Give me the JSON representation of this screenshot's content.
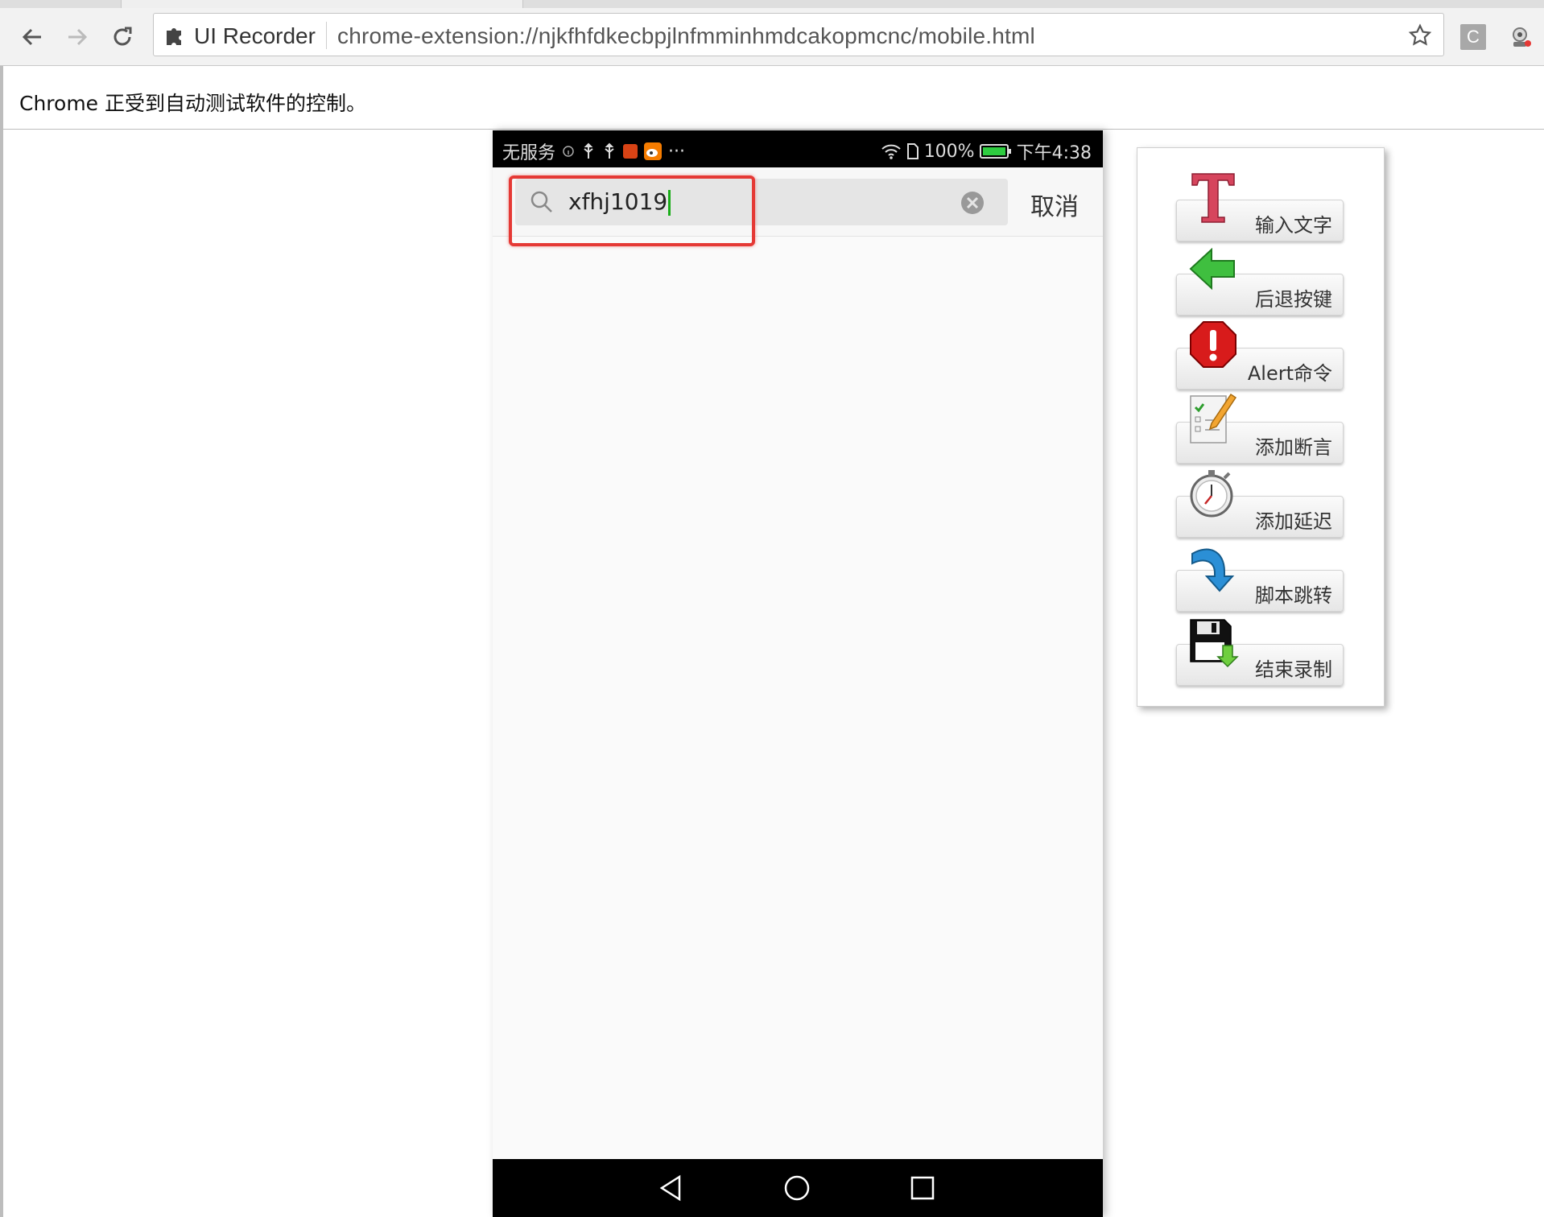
{
  "browser": {
    "site_name": "UI Recorder",
    "url": "chrome-extension://njkfhfdkecbpjlnfmminhmdcakopmcnc/mobile.html",
    "ext_c_label": "C",
    "infobar_text": "Chrome 正受到自动测试软件的控制。"
  },
  "phone": {
    "status": {
      "carrier": "无服务",
      "more": "···",
      "battery": "100%",
      "time": "下午4:38"
    },
    "search": {
      "query": "xfhj1019",
      "cancel_label": "取消"
    }
  },
  "panel": {
    "tools": [
      {
        "label": "输入文字",
        "icon": "text-t-icon"
      },
      {
        "label": "后退按键",
        "icon": "back-arrow-icon"
      },
      {
        "label": "Alert命令",
        "icon": "alert-stop-icon"
      },
      {
        "label": "添加断言",
        "icon": "checklist-pencil-icon"
      },
      {
        "label": "添加延迟",
        "icon": "stopwatch-icon"
      },
      {
        "label": "脚本跳转",
        "icon": "curved-arrow-icon"
      },
      {
        "label": "结束录制",
        "icon": "save-disk-icon"
      }
    ]
  },
  "colors": {
    "highlight": "#e53935",
    "caret": "#1aad19",
    "status_bar": "#000000"
  }
}
